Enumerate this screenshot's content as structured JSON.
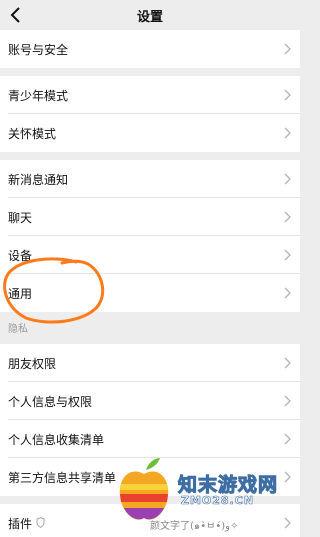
{
  "header": {
    "title": "设置",
    "back_icon": "chevron-left-icon"
  },
  "menu": {
    "account_security": "账号与安全",
    "teen_mode": "青少年模式",
    "care_mode": "关怀模式",
    "new_message_notify": "新消息通知",
    "chat": "聊天",
    "device": "设备",
    "general": "通用",
    "privacy_section": "隐私",
    "friend_permissions": "朋友权限",
    "personal_info_permissions": "个人信息与权限",
    "personal_info_list": "个人信息收集清单",
    "third_party_list": "第三方信息共享清单",
    "plugins": "插件",
    "plugins_partial_text": "颜文字了(๑•̀ㅂ•́)و✧"
  },
  "annotation": {
    "color": "#ff7a1a",
    "shape": "hand-drawn circle around 通用"
  },
  "watermark": {
    "text": "知末游戏网",
    "sub": "ZMO28.CN"
  }
}
